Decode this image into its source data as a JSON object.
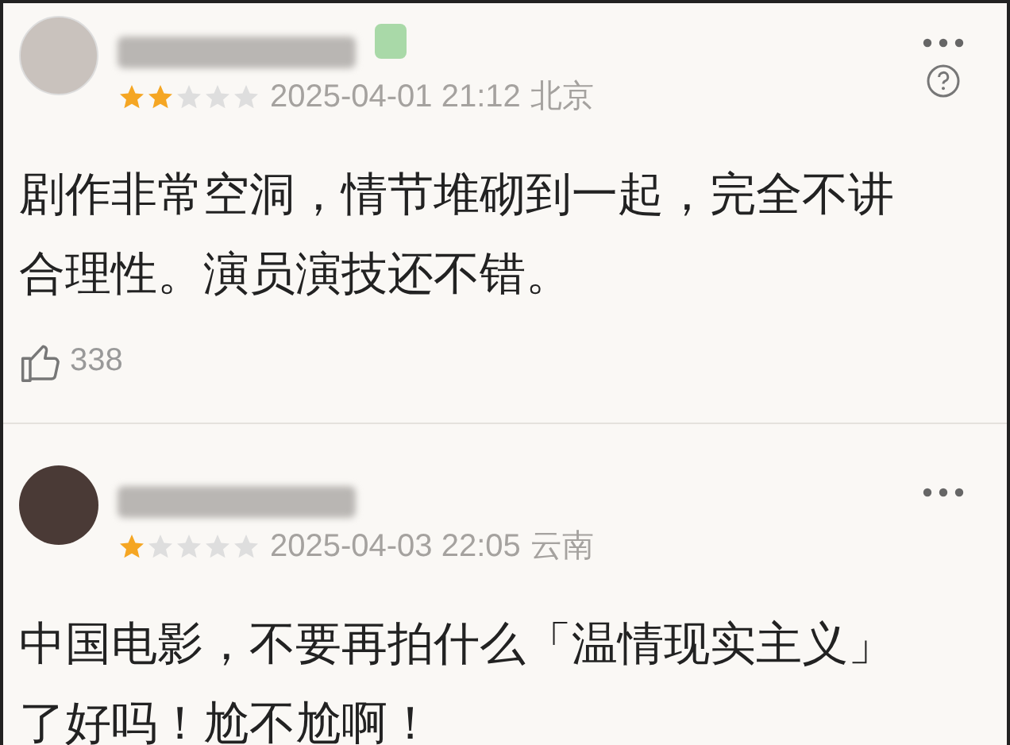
{
  "reviews": [
    {
      "stars": 2,
      "time": "2025-04-01 21:12",
      "location": "北京",
      "verified_badge": true,
      "help_icon": true,
      "text": "剧作非常空洞，情节堆砌到一起，完全不讲合理性。演员演技还不错。",
      "likes": "338"
    },
    {
      "stars": 1,
      "time": "2025-04-03 22:05",
      "location": "云南",
      "verified_badge": false,
      "help_icon": false,
      "text": "中国电影，不要再拍什么「温情现实主义」了好吗！尬不尬啊！"
    }
  ]
}
